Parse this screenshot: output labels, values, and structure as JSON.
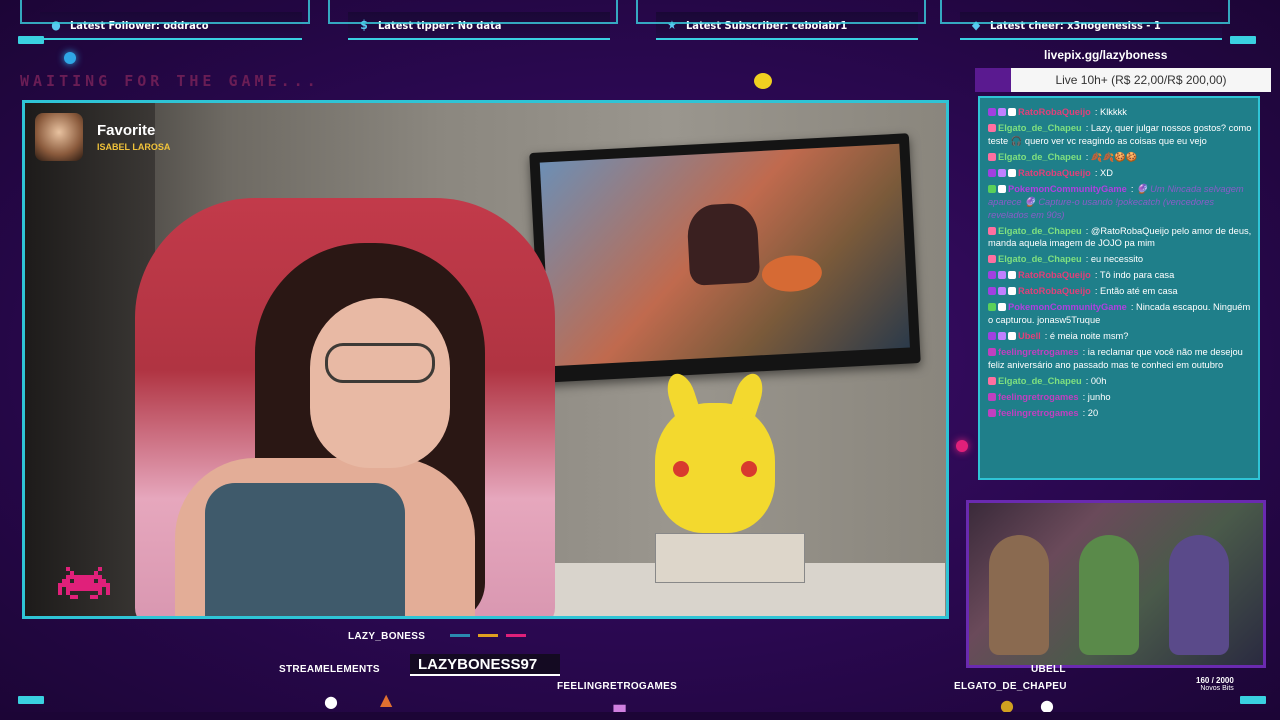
{
  "alerts": [
    {
      "icon": "person-icon",
      "label": "Latest Follower: oddraco"
    },
    {
      "icon": "dollar-icon",
      "label": "Latest tipper: No data"
    },
    {
      "icon": "star-icon",
      "label": "Latest Subscriber: cebolabr1"
    },
    {
      "icon": "diamond-icon",
      "label": "Latest cheer: x3nogenesiss - 1"
    }
  ],
  "waiting_text": "WAITING FOR THE GAME...",
  "favorite": {
    "title": "Favorite",
    "subtitle": "ISABEL LAROSA"
  },
  "livepix": {
    "url": "livepix.gg/lazyboness",
    "goal": "Live 10h+ (R$ 22,00/R$ 200,00)"
  },
  "chat": [
    {
      "user": "RatoRobaQueijo",
      "color": "#e0407a",
      "badges": [
        "#a040e0",
        "#c080ff",
        "#ffffff"
      ],
      "text": "Klkkkk"
    },
    {
      "user": "Elgato_de_Chapeu",
      "color": "#7fe07f",
      "badges": [
        "#ff6fa0"
      ],
      "text": "Lazy, quer julgar nossos gostos? como teste 🎧 quero ver vc reagindo as coisas que eu vejo"
    },
    {
      "user": "Elgato_de_Chapeu",
      "color": "#7fe07f",
      "badges": [
        "#ff6fa0"
      ],
      "text": "🍂🍂🍪🍪"
    },
    {
      "user": "RatoRobaQueijo",
      "color": "#e0407a",
      "badges": [
        "#a040e0",
        "#c080ff",
        "#ffffff"
      ],
      "text": "XD"
    },
    {
      "user": "PokemonCommunityGame",
      "color": "#b040e0",
      "badges": [
        "#5ad05a",
        "#ffffff"
      ],
      "text": "🔮 Um Nincada selvagem aparece 🔮 Capture-o usando !pokecatch (vencedores revelados em 90s)",
      "italic": true
    },
    {
      "user": "Elgato_de_Chapeu",
      "color": "#7fe07f",
      "badges": [
        "#ff6fa0"
      ],
      "text": "@RatoRobaQueijo pelo amor de deus, manda aquela imagem de JOJO pa mim"
    },
    {
      "user": "Elgato_de_Chapeu",
      "color": "#7fe07f",
      "badges": [
        "#ff6fa0"
      ],
      "text": "eu necessito"
    },
    {
      "user": "RatoRobaQueijo",
      "color": "#e0407a",
      "badges": [
        "#a040e0",
        "#c080ff",
        "#ffffff"
      ],
      "text": "Tô indo para casa"
    },
    {
      "user": "RatoRobaQueijo",
      "color": "#e0407a",
      "badges": [
        "#a040e0",
        "#c080ff",
        "#ffffff"
      ],
      "text": "Então até em casa"
    },
    {
      "user": "PokemonCommunityGame",
      "color": "#b040e0",
      "badges": [
        "#5ad05a",
        "#ffffff"
      ],
      "text": "Nincada escapou. Ninguém o capturou. jonasw5Truque"
    },
    {
      "user": "Ubell",
      "color": "#e0407a",
      "badges": [
        "#a040e0",
        "#c080ff",
        "#ffffff"
      ],
      "text": "é meia noite msm?"
    },
    {
      "user": "feelingretrogames",
      "color": "#c040c0",
      "badges": [
        "#c040c0"
      ],
      "text": "ia reclamar que você não me desejou feliz aniversário ano passado mas te conheci em outubro"
    },
    {
      "user": "Elgato_de_Chapeu",
      "color": "#7fe07f",
      "badges": [
        "#ff6fa0"
      ],
      "text": "00h"
    },
    {
      "user": "feelingretrogames",
      "color": "#c040c0",
      "badges": [
        "#c040c0"
      ],
      "text": "junho"
    },
    {
      "user": "feelingretrogames",
      "color": "#c040c0",
      "badges": [
        "#c040c0"
      ],
      "text": "20"
    }
  ],
  "labels": {
    "cam": "LAZY_BONESS",
    "streamelements": "STREAMELEMENTS",
    "bigname": "LAZYBONESS97",
    "feeling": "FEELINGRETROGAMES",
    "ubell": "UBELL",
    "elgato": "ELGATO_DE_CHAPEU"
  },
  "bits": {
    "value": "160 / 2000",
    "label": "Novos Bits"
  },
  "colors": {
    "accent": "#2fc4d6",
    "purple": "#6a2ab0",
    "background": "#2a0850"
  }
}
